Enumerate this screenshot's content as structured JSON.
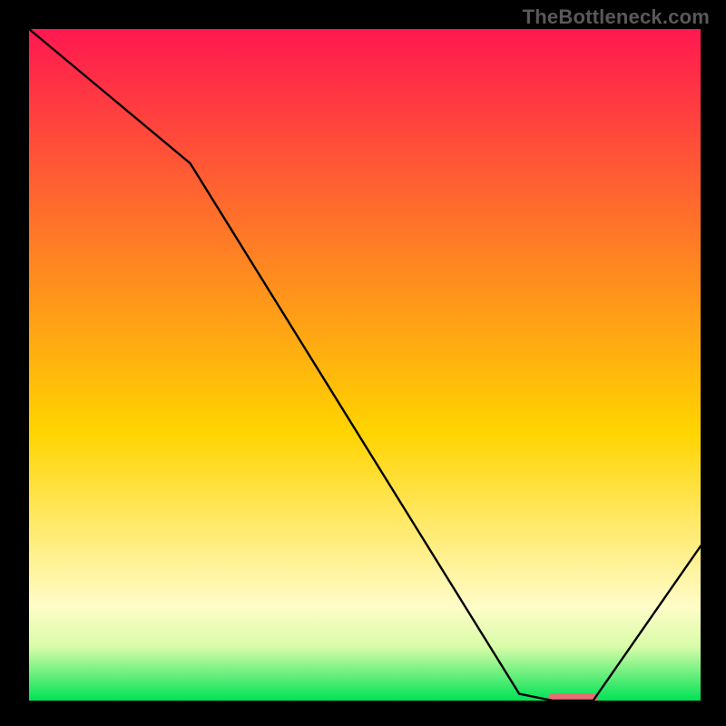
{
  "watermark": "TheBottleneck.com",
  "chart_data": {
    "type": "line",
    "title": "",
    "xlabel": "",
    "ylabel": "",
    "xlim": [
      0,
      100
    ],
    "ylim": [
      0,
      100
    ],
    "grid": false,
    "legend": false,
    "series": [
      {
        "name": "curve",
        "x": [
          0,
          24,
          73,
          78,
          84,
          100
        ],
        "y": [
          100,
          80,
          1,
          0,
          0,
          23
        ]
      }
    ],
    "highlight_segment": {
      "x0": 78,
      "x1": 84,
      "color": "#e46f74",
      "thickness": 10
    },
    "background_gradient_stops": [
      {
        "pct": 0.0,
        "color": "#ff1850"
      },
      {
        "pct": 0.6,
        "color": "#ffd400"
      },
      {
        "pct": 0.86,
        "color": "#fffcc8"
      },
      {
        "pct": 0.92,
        "color": "#d8fca8"
      },
      {
        "pct": 1.0,
        "color": "#00e255"
      }
    ]
  }
}
